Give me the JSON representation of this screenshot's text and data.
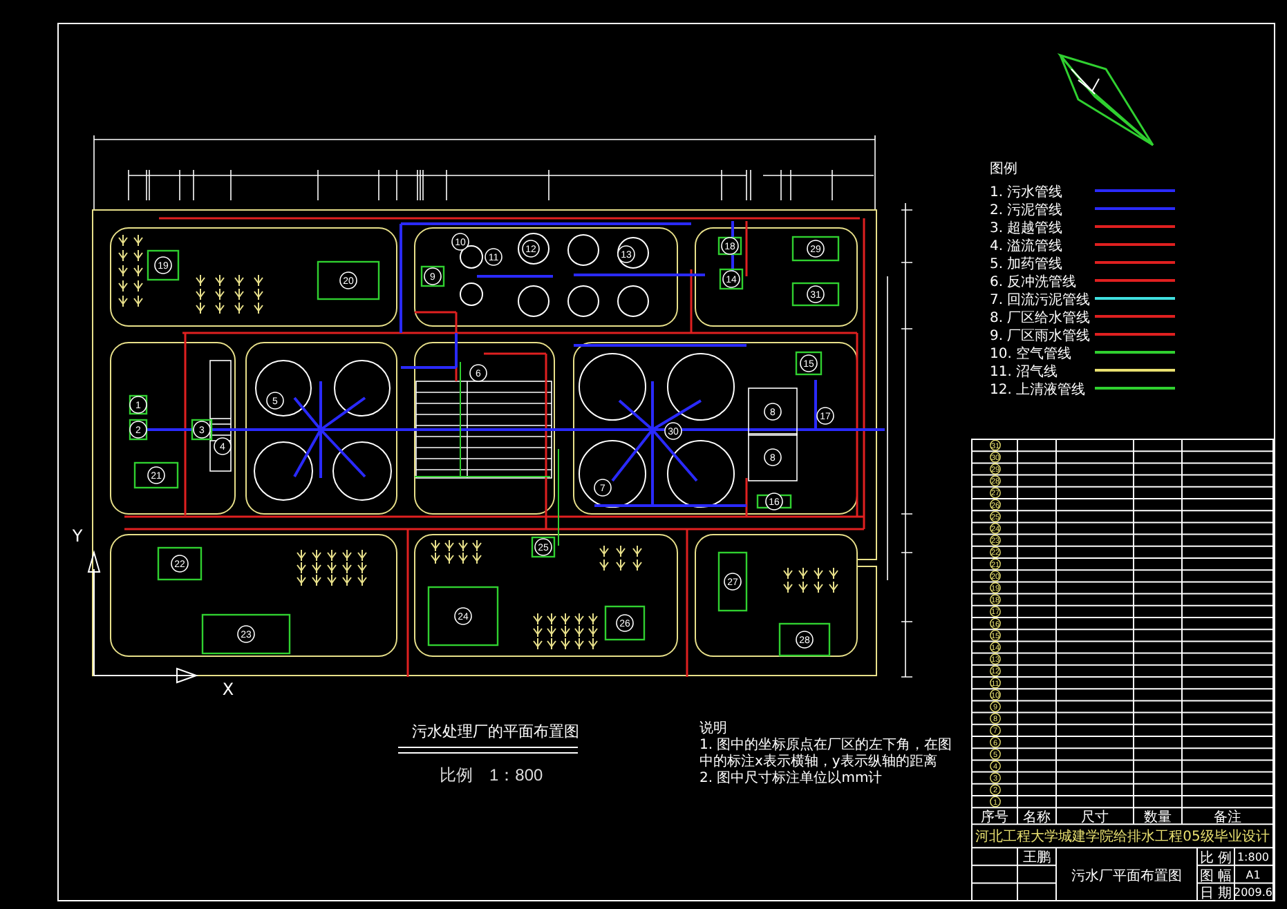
{
  "legend": {
    "title": "图例",
    "items": [
      {
        "label": "1. 污水管线",
        "color": "#2a2aff"
      },
      {
        "label": "2. 污泥管线",
        "color": "#2a2aff"
      },
      {
        "label": "3. 超越管线",
        "color": "#e02020"
      },
      {
        "label": "4. 溢流管线",
        "color": "#e02020"
      },
      {
        "label": "5. 加药管线",
        "color": "#e02020"
      },
      {
        "label": "6. 反冲洗管线",
        "color": "#e02020"
      },
      {
        "label": "7. 回流污泥管线",
        "color": "#40e0e0"
      },
      {
        "label": "8. 厂区给水管线",
        "color": "#e02020"
      },
      {
        "label": "9. 厂区雨水管线",
        "color": "#e02020"
      },
      {
        "label": "10. 空气管线",
        "color": "#30d030"
      },
      {
        "label": "11. 沼气线",
        "color": "#e8e070"
      },
      {
        "label": "12. 上清液管线",
        "color": "#30d030"
      }
    ]
  },
  "plan": {
    "axes": {
      "y_label": "Y",
      "x_label": "X"
    },
    "units": [
      {
        "number": "1",
        "kind": "box"
      },
      {
        "number": "2",
        "kind": "box"
      },
      {
        "number": "3",
        "kind": "box"
      },
      {
        "number": "4",
        "kind": "plain"
      },
      {
        "number": "5",
        "kind": "plain"
      },
      {
        "number": "6",
        "kind": "plain"
      },
      {
        "number": "7",
        "kind": "plain"
      },
      {
        "number": "8",
        "kind": "plain"
      },
      {
        "number": "8",
        "kind": "plain"
      },
      {
        "number": "9",
        "kind": "box"
      },
      {
        "number": "10",
        "kind": "plain"
      },
      {
        "number": "11",
        "kind": "plain"
      },
      {
        "number": "12",
        "kind": "plain"
      },
      {
        "number": "13",
        "kind": "plain"
      },
      {
        "number": "14",
        "kind": "box"
      },
      {
        "number": "15",
        "kind": "box"
      },
      {
        "number": "16",
        "kind": "box"
      },
      {
        "number": "17",
        "kind": "plain"
      },
      {
        "number": "18",
        "kind": "box"
      },
      {
        "number": "19",
        "kind": "box"
      },
      {
        "number": "20",
        "kind": "box"
      },
      {
        "number": "21",
        "kind": "box"
      },
      {
        "number": "22",
        "kind": "box"
      },
      {
        "number": "23",
        "kind": "box"
      },
      {
        "number": "24",
        "kind": "box"
      },
      {
        "number": "25",
        "kind": "box"
      },
      {
        "number": "26",
        "kind": "box"
      },
      {
        "number": "27",
        "kind": "box"
      },
      {
        "number": "28",
        "kind": "box"
      },
      {
        "number": "29",
        "kind": "box"
      },
      {
        "number": "30",
        "kind": "plain"
      },
      {
        "number": "31",
        "kind": "box"
      }
    ]
  },
  "plan_title": "污水处理厂的平面布置图",
  "scale": "比例　1：800",
  "notes": {
    "title": "说明",
    "items": [
      "1. 图中的坐标原点在厂区的左下角，在图中的标注x表示横轴，y表示纵轴的距离",
      "2. 图中尺寸标注单位以mm计"
    ]
  },
  "table": {
    "rows": [
      "31",
      "30",
      "29",
      "28",
      "27",
      "26",
      "25",
      "24",
      "23",
      "22",
      "21",
      "20",
      "19",
      "18",
      "17",
      "16",
      "15",
      "14",
      "13",
      "12",
      "11",
      "10",
      "9",
      "8",
      "7",
      "6",
      "5",
      "4",
      "3",
      "2",
      "1"
    ],
    "header": [
      "序号",
      "名称",
      "尺寸",
      "数量",
      "备注"
    ]
  },
  "title_block": {
    "school": "河北工程大学城建学院给排水工程05级毕业设计",
    "designer": "王鹏",
    "drawing_title": "污水厂平面布置图",
    "fields": [
      {
        "label": "比 例",
        "value": "1:800"
      },
      {
        "label": "图 幅",
        "value": "A1"
      },
      {
        "label": "日 期",
        "value": "2009.6"
      }
    ]
  }
}
